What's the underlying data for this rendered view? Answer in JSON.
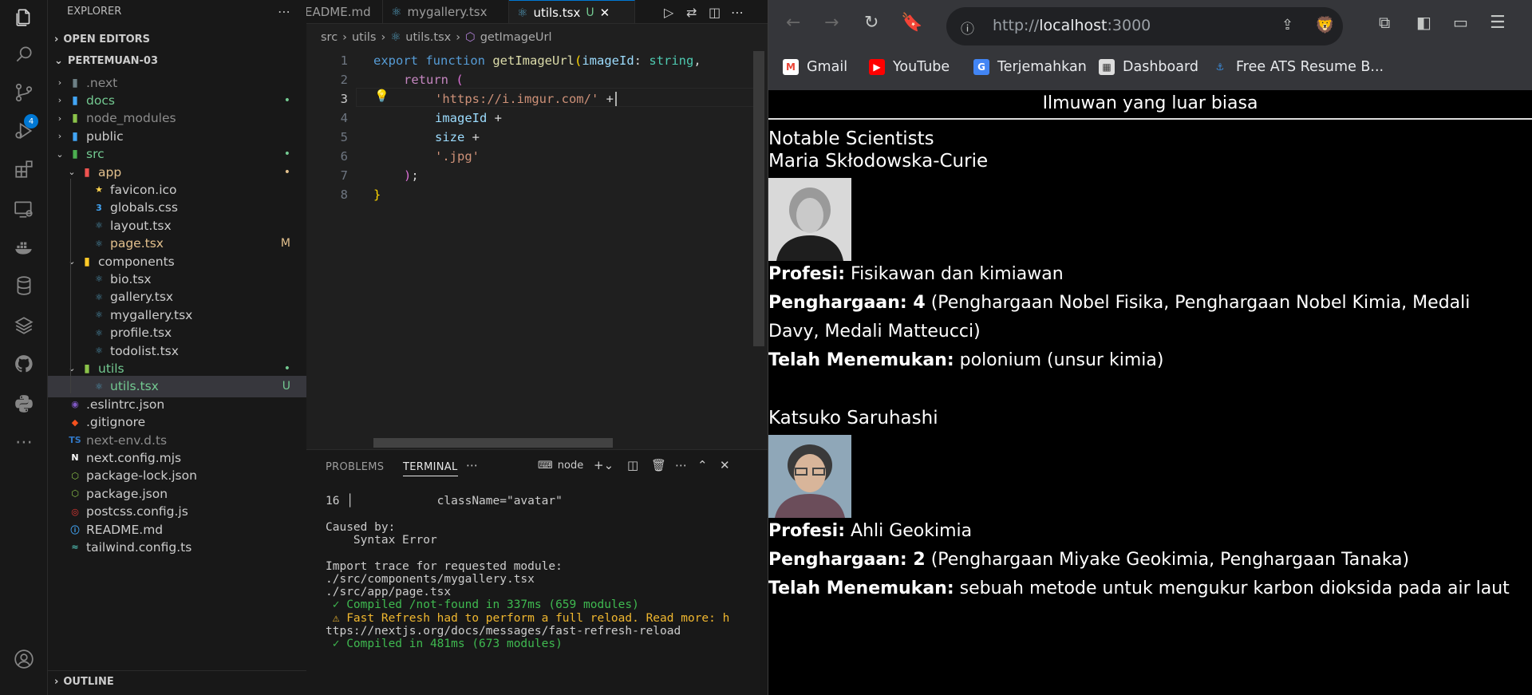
{
  "explorer": {
    "title": "EXPLORER",
    "open_editors": "OPEN EDITORS",
    "project": "PERTEMUAN-03",
    "outline": "OUTLINE",
    "tree": [
      {
        "label": ".next",
        "depth": 0,
        "chev": "›",
        "icon": "folder-next",
        "color": "#8c8c8c",
        "badge": ""
      },
      {
        "label": "docs",
        "depth": 0,
        "chev": "›",
        "icon": "folder-docs",
        "color": "#73c991",
        "badge": "•"
      },
      {
        "label": "node_modules",
        "depth": 0,
        "chev": "›",
        "icon": "folder-node",
        "color": "#8c8c8c",
        "badge": ""
      },
      {
        "label": "public",
        "depth": 0,
        "chev": "›",
        "icon": "folder-public",
        "color": "#cccccc",
        "badge": ""
      },
      {
        "label": "src",
        "depth": 0,
        "chev": "⌄",
        "icon": "folder-src",
        "color": "#73c991",
        "badge": "•"
      },
      {
        "label": "app",
        "depth": 1,
        "chev": "⌄",
        "icon": "folder-app",
        "color": "#e2c08d",
        "badge": "•"
      },
      {
        "label": "favicon.ico",
        "depth": 2,
        "chev": "",
        "icon": "star-icon",
        "color": "#cccccc",
        "badge": ""
      },
      {
        "label": "globals.css",
        "depth": 2,
        "chev": "",
        "icon": "css-icon",
        "color": "#cccccc",
        "badge": ""
      },
      {
        "label": "layout.tsx",
        "depth": 2,
        "chev": "",
        "icon": "react-icon",
        "color": "#cccccc",
        "badge": ""
      },
      {
        "label": "page.tsx",
        "depth": 2,
        "chev": "",
        "icon": "react-icon",
        "color": "#e2c08d",
        "badge": "M"
      },
      {
        "label": "components",
        "depth": 1,
        "chev": "⌄",
        "icon": "folder-components",
        "color": "#cccccc",
        "badge": ""
      },
      {
        "label": "bio.tsx",
        "depth": 2,
        "chev": "",
        "icon": "react-icon",
        "color": "#cccccc",
        "badge": ""
      },
      {
        "label": "gallery.tsx",
        "depth": 2,
        "chev": "",
        "icon": "react-icon",
        "color": "#cccccc",
        "badge": ""
      },
      {
        "label": "mygallery.tsx",
        "depth": 2,
        "chev": "",
        "icon": "react-icon",
        "color": "#cccccc",
        "badge": ""
      },
      {
        "label": "profile.tsx",
        "depth": 2,
        "chev": "",
        "icon": "react-icon",
        "color": "#cccccc",
        "badge": ""
      },
      {
        "label": "todolist.tsx",
        "depth": 2,
        "chev": "",
        "icon": "react-icon",
        "color": "#cccccc",
        "badge": ""
      },
      {
        "label": "utils",
        "depth": 1,
        "chev": "⌄",
        "icon": "folder-utils",
        "color": "#73c991",
        "badge": "•"
      },
      {
        "label": "utils.tsx",
        "depth": 2,
        "chev": "",
        "icon": "react-icon",
        "color": "#73c991",
        "badge": "U"
      },
      {
        "label": ".eslintrc.json",
        "depth": 0,
        "chev": "",
        "icon": "eslint-icon",
        "color": "#cccccc",
        "badge": ""
      },
      {
        "label": ".gitignore",
        "depth": 0,
        "chev": "",
        "icon": "git-icon",
        "color": "#cccccc",
        "badge": ""
      },
      {
        "label": "next-env.d.ts",
        "depth": 0,
        "chev": "",
        "icon": "ts-icon",
        "color": "#8c8c8c",
        "badge": ""
      },
      {
        "label": "next.config.mjs",
        "depth": 0,
        "chev": "",
        "icon": "next-icon",
        "color": "#cccccc",
        "badge": ""
      },
      {
        "label": "package-lock.json",
        "depth": 0,
        "chev": "",
        "icon": "npm-icon",
        "color": "#cccccc",
        "badge": ""
      },
      {
        "label": "package.json",
        "depth": 0,
        "chev": "",
        "icon": "npm-icon",
        "color": "#cccccc",
        "badge": ""
      },
      {
        "label": "postcss.config.js",
        "depth": 0,
        "chev": "",
        "icon": "postcss-icon",
        "color": "#cccccc",
        "badge": ""
      },
      {
        "label": "README.md",
        "depth": 0,
        "chev": "",
        "icon": "info-icon",
        "color": "#cccccc",
        "badge": ""
      },
      {
        "label": "tailwind.config.ts",
        "depth": 0,
        "chev": "",
        "icon": "tailwind-icon",
        "color": "#cccccc",
        "badge": ""
      }
    ],
    "selected_index": 17
  },
  "activity_bar": {
    "scm_badge": "4"
  },
  "editor": {
    "tabs": [
      {
        "label": "EADME.md",
        "icon": "info-icon",
        "modified": ""
      },
      {
        "label": "mygallery.tsx",
        "icon": "react-icon",
        "modified": ""
      },
      {
        "label": "utils.tsx",
        "icon": "react-icon",
        "modified": "U"
      }
    ],
    "breadcrumb": [
      "src",
      "utils",
      "utils.tsx",
      "getImageUrl"
    ],
    "line_numbers": [
      "1",
      "2",
      "3",
      "4",
      "5",
      "6",
      "7",
      "8"
    ],
    "current_line": 3
  },
  "panel": {
    "tabs": [
      "PROBLEMS",
      "TERMINAL"
    ],
    "active_tab": "TERMINAL",
    "terminal_name": "node",
    "lines": [
      {
        "text": "16 │            className=\"avatar\"",
        "cls": ""
      },
      {
        "text": "",
        "cls": ""
      },
      {
        "text": "Caused by:",
        "cls": ""
      },
      {
        "text": "    Syntax Error",
        "cls": ""
      },
      {
        "text": "",
        "cls": ""
      },
      {
        "text": "Import trace for requested module:",
        "cls": ""
      },
      {
        "text": "./src/components/mygallery.tsx",
        "cls": ""
      },
      {
        "text": "./src/app/page.tsx",
        "cls": ""
      },
      {
        "text": " ✓ Compiled /not-found in 337ms (659 modules)",
        "cls": "ok"
      },
      {
        "text": " ⚠ Fast Refresh had to perform a full reload. Read more: h",
        "cls": "warn"
      },
      {
        "text": "ttps://nextjs.org/docs/messages/fast-refresh-reload",
        "cls": ""
      },
      {
        "text": " ✓ Compiled in 481ms (673 modules)",
        "cls": "ok"
      }
    ]
  },
  "browser": {
    "url_host": "localhost",
    "url_prefix": "http://",
    "url_port": ":3000",
    "bookmarks": [
      {
        "label": "Gmail",
        "icon": "gmail-icon"
      },
      {
        "label": "YouTube",
        "icon": "youtube-icon"
      },
      {
        "label": "Terjemahkan",
        "icon": "translate-icon"
      },
      {
        "label": "Dashboard",
        "icon": "dashboard-icon"
      },
      {
        "label": "Free ATS Resume B...",
        "icon": "resume-icon"
      }
    ],
    "page": {
      "header": "Ilmuwan yang luar biasa",
      "section_title": "Notable Scientists",
      "scientists": [
        {
          "name": "Maria Skłodowska-Curie",
          "profession_label": "Profesi:",
          "profession": "Fisikawan dan kimiawan",
          "awards_label": "Penghargaan: 4",
          "awards": "(Penghargaan Nobel Fisika, Penghargaan Nobel Kimia, Medali Davy, Medali Matteucci)",
          "discovery_label": "Telah Menemukan:",
          "discovery": "polonium (unsur kimia)"
        },
        {
          "name": "Katsuko Saruhashi",
          "profession_label": "Profesi:",
          "profession": "Ahli Geokimia",
          "awards_label": "Penghargaan: 2",
          "awards": "(Penghargaan Miyake Geokimia, Penghargaan Tanaka)",
          "discovery_label": "Telah Menemukan:",
          "discovery": "sebuah metode untuk mengukur karbon dioksida pada air laut"
        }
      ]
    }
  }
}
